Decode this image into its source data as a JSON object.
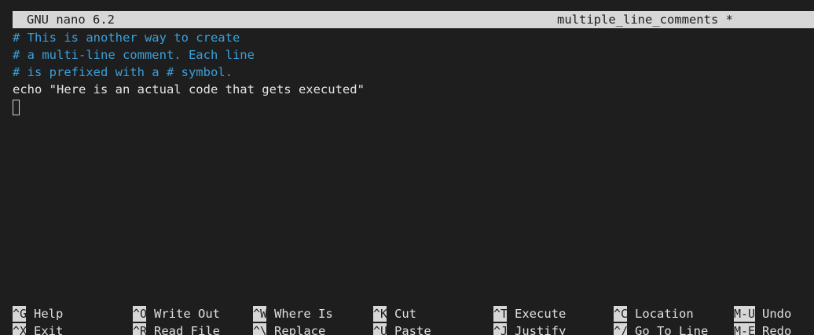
{
  "titlebar": {
    "version": "GNU nano 6.2",
    "filename": "multiple_line_comments *"
  },
  "editor": {
    "lines": [
      {
        "text": "# This is another way to create",
        "kind": "comment"
      },
      {
        "text": "# a multi-line comment. Each line",
        "kind": "comment"
      },
      {
        "text": "# is prefixed with a # symbol.",
        "kind": "comment"
      },
      {
        "text": "echo \"Here is an actual code that gets executed\"",
        "kind": "code"
      }
    ]
  },
  "shortcuts": [
    [
      {
        "key": "^G",
        "label": "Help"
      },
      {
        "key": "^X",
        "label": "Exit"
      }
    ],
    [
      {
        "key": "^O",
        "label": "Write Out"
      },
      {
        "key": "^R",
        "label": "Read File"
      }
    ],
    [
      {
        "key": "^W",
        "label": "Where Is"
      },
      {
        "key": "^\\",
        "label": "Replace"
      }
    ],
    [
      {
        "key": "^K",
        "label": "Cut"
      },
      {
        "key": "^U",
        "label": "Paste"
      }
    ],
    [
      {
        "key": "^T",
        "label": "Execute"
      },
      {
        "key": "^J",
        "label": "Justify"
      }
    ],
    [
      {
        "key": "^C",
        "label": "Location"
      },
      {
        "key": "^/",
        "label": "Go To Line"
      }
    ],
    [
      {
        "key": "M-U",
        "label": "Undo"
      },
      {
        "key": "M-E",
        "label": "Redo"
      }
    ]
  ],
  "colors": {
    "background": "#1e1e1e",
    "comment": "#3aa0d8",
    "bar": "#d7d7d7"
  }
}
